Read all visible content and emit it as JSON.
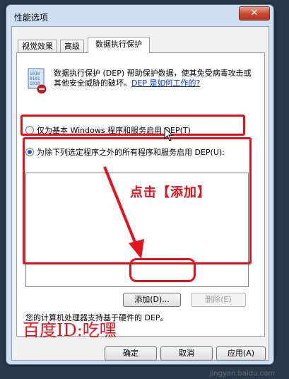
{
  "window": {
    "title": "性能选项",
    "close_label": "✕"
  },
  "tabs": [
    {
      "label": "视觉效果"
    },
    {
      "label": "高级"
    },
    {
      "label": "数据执行保护"
    }
  ],
  "dep": {
    "description": "数据执行保护 (DEP) 帮助保护数据，使其免受病毒攻击或其他安全威胁的破坏。",
    "link": "DEP 是如何工作的?",
    "radio_basic_label": "仅为基本 Windows 程序和服务启用 DEP(T)",
    "radio_all_label": "为除下列选定程序之外的所有程序和服务启用 DEP(U):",
    "selected_option": "radio_all"
  },
  "buttons": {
    "add": "添加(D)...",
    "remove": "删除(E)",
    "ok": "确定",
    "cancel": "取消",
    "apply": "应用(A)"
  },
  "footnote": "您的计算机处理器支持基于硬件的 DEP。",
  "annotation": {
    "text": "点击【添加】",
    "color": "#e3121b"
  },
  "watermark": {
    "id_text": "百度ID:吃嘿",
    "site": "jingyan.baidu.com"
  },
  "icons": {
    "dep_icon": "dep-shield-icon",
    "cursor": "mouse-cursor-icon",
    "arrow": "annotation-arrow"
  }
}
